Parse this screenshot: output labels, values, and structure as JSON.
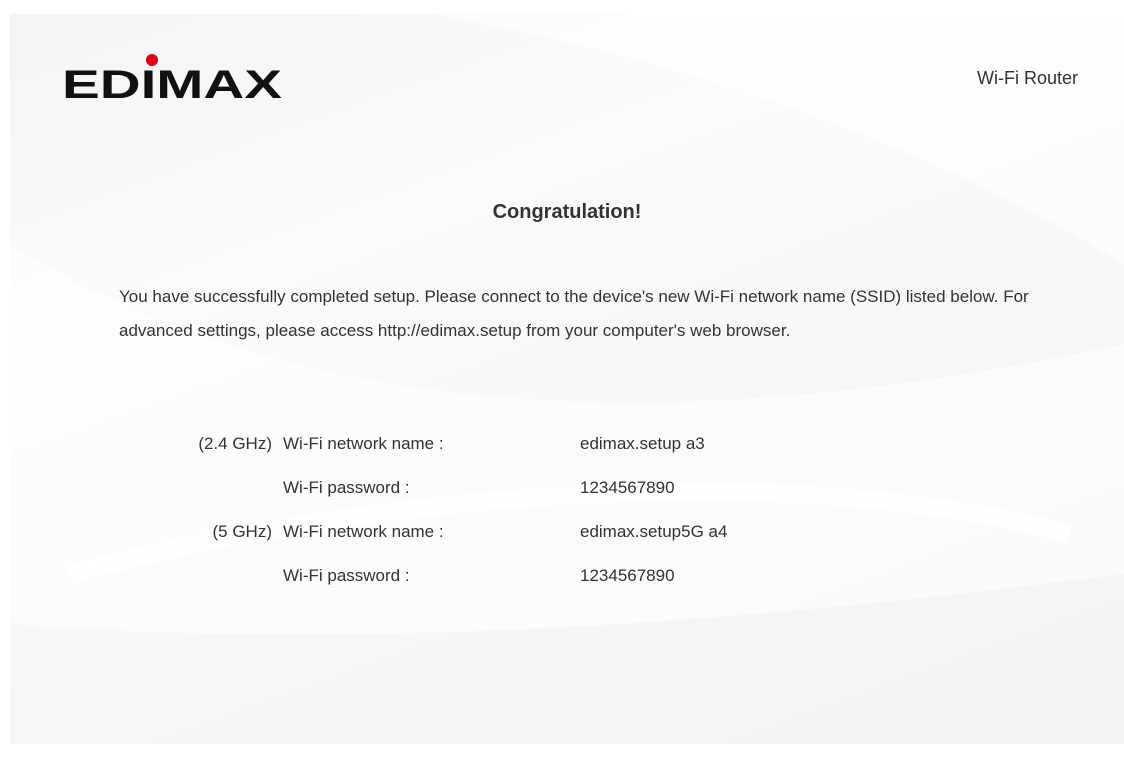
{
  "header": {
    "logo_text": "EDIMAX",
    "product_name": "Wi-Fi Router"
  },
  "main": {
    "title": "Congratulation!",
    "message": "You have successfully completed setup. Please connect to the device's new Wi-Fi network name (SSID) listed below. For advanced settings, please access http://edimax.setup from your computer's web browser.",
    "rows": [
      {
        "band": "(2.4 GHz)",
        "label": "Wi-Fi network name :",
        "value": "edimax.setup a3"
      },
      {
        "band": "",
        "label": "Wi-Fi password :",
        "value": "1234567890"
      },
      {
        "band": "(5 GHz)",
        "label": "Wi-Fi network name :",
        "value": "edimax.setup5G a4"
      },
      {
        "band": "",
        "label": "Wi-Fi password :",
        "value": "1234567890"
      }
    ]
  },
  "colors": {
    "logo": "#111111",
    "logo_dot": "#e60012",
    "text": "#333333",
    "background": "#f7f7f7"
  }
}
